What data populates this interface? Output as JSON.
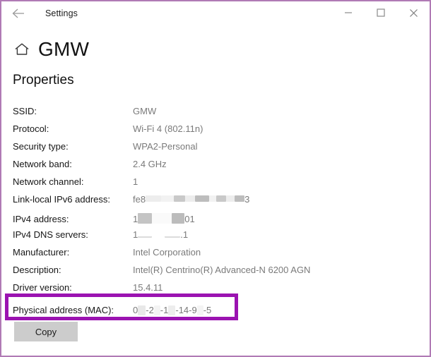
{
  "window": {
    "border_color": "#b07ab5",
    "titlebar": {
      "back_label": "Back",
      "title": "Settings",
      "minimize_label": "Minimize",
      "maximize_label": "Maximize",
      "close_label": "Close"
    }
  },
  "header": {
    "home_icon": "home-icon",
    "page_title": "GMW",
    "section_title": "Properties"
  },
  "properties": {
    "rows": [
      {
        "label": "SSID:",
        "value": "GMW",
        "redacted": false
      },
      {
        "label": "Protocol:",
        "value": "Wi-Fi 4 (802.11n)",
        "redacted": false
      },
      {
        "label": "Security type:",
        "value": "WPA2-Personal",
        "redacted": false
      },
      {
        "label": "Network band:",
        "value": "2.4 GHz",
        "redacted": false
      },
      {
        "label": "Network channel:",
        "value": "1",
        "redacted": false
      },
      {
        "label": "Link-local IPv6 address:",
        "value_prefix": "fe8",
        "value_suffix": "3",
        "redacted": true
      },
      {
        "label": "IPv4 address:",
        "value_prefix": "1",
        "value_suffix": "01",
        "redacted": true
      },
      {
        "label": "IPv4 DNS servers:",
        "value_prefix": "1",
        "value_suffix": ".1",
        "redacted": true
      },
      {
        "label": "Manufacturer:",
        "value": "Intel Corporation",
        "redacted": false
      },
      {
        "label": "Description:",
        "value": "Intel(R) Centrino(R) Advanced-N 6200 AGN",
        "redacted": false
      },
      {
        "label": "Driver version:",
        "value": "15.4.11",
        "redacted": false
      },
      {
        "label": "Physical address (MAC):",
        "value": "0 -2 -1 -14-9 -5",
        "redacted": true
      }
    ]
  },
  "mac_row": {
    "label": "Physical address (MAC):",
    "segments": [
      "0",
      "-2",
      "-1",
      "-14-9",
      "-5"
    ]
  },
  "highlight": {
    "color": "#9b13b1",
    "target": "Physical address (MAC)"
  },
  "actions": {
    "copy_label": "Copy"
  }
}
